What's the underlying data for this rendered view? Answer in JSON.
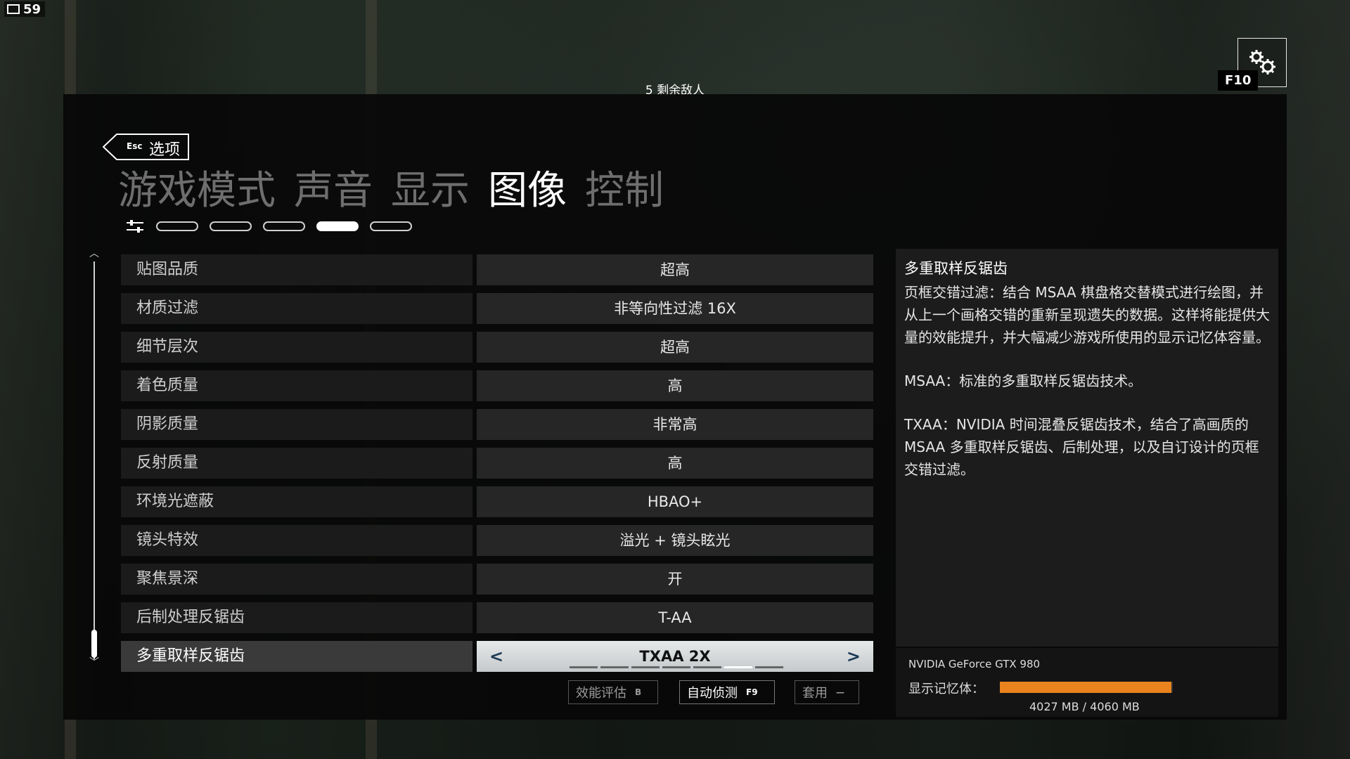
{
  "hud": {
    "fps": "59",
    "enemies_text": "5 剩余敌人",
    "settings_key": "F10"
  },
  "header": {
    "esc_key": "Esc",
    "back_label": "选项"
  },
  "tabs": [
    {
      "label": "游戏模式",
      "active": false
    },
    {
      "label": "声音",
      "active": false
    },
    {
      "label": "显示",
      "active": false
    },
    {
      "label": "图像",
      "active": true
    },
    {
      "label": "控制",
      "active": false
    }
  ],
  "settings": [
    {
      "label": "贴图品质",
      "value": "超高"
    },
    {
      "label": "材质过滤",
      "value": "非等向性过滤 16X"
    },
    {
      "label": "细节层次",
      "value": "超高"
    },
    {
      "label": "着色质量",
      "value": "高"
    },
    {
      "label": "阴影质量",
      "value": "非常高"
    },
    {
      "label": "反射质量",
      "value": "高"
    },
    {
      "label": "环境光遮蔽",
      "value": "HBAO+"
    },
    {
      "label": "镜头特效",
      "value": "溢光 + 镜头眩光"
    },
    {
      "label": "聚焦景深",
      "value": "开"
    },
    {
      "label": "后制处理反锯齿",
      "value": "T-AA"
    },
    {
      "label": "多重取样反锯齿",
      "value": "TXAA 2X",
      "selected": true,
      "prev": "<",
      "next": ">"
    }
  ],
  "buttons": {
    "benchmark": {
      "label": "效能评估",
      "key": "B"
    },
    "autodetect": {
      "label": "自动侦测",
      "key": "F9"
    },
    "apply": {
      "label": "套用",
      "key": "—"
    }
  },
  "description": {
    "title": "多重取样反锯齿",
    "paragraphs": [
      "页框交错过滤：结合 MSAA 棋盘格交替模式进行绘图，并从上一个画格交错的重新呈现遗失的数据。这样将能提供大量的效能提升，并大幅减少游戏所使用的显示记忆体容量。",
      "MSAA：标准的多重取样反锯齿技术。",
      "TXAA：NVIDIA 时间混叠反锯齿技术，结合了高画质的 MSAA 多重取样反锯齿、后制处理，以及自订设计的页框交错过滤。"
    ]
  },
  "gpu": {
    "name": "NVIDIA GeForce GTX 980",
    "mem_label": "显示记忆体：",
    "mem_value": "4027 MB / 4060 MB",
    "mem_used_fraction": 0.992
  },
  "colors": {
    "accent": "#e8831e",
    "selected_bg": "#d6dadc",
    "arrow": "#1c3a55"
  }
}
